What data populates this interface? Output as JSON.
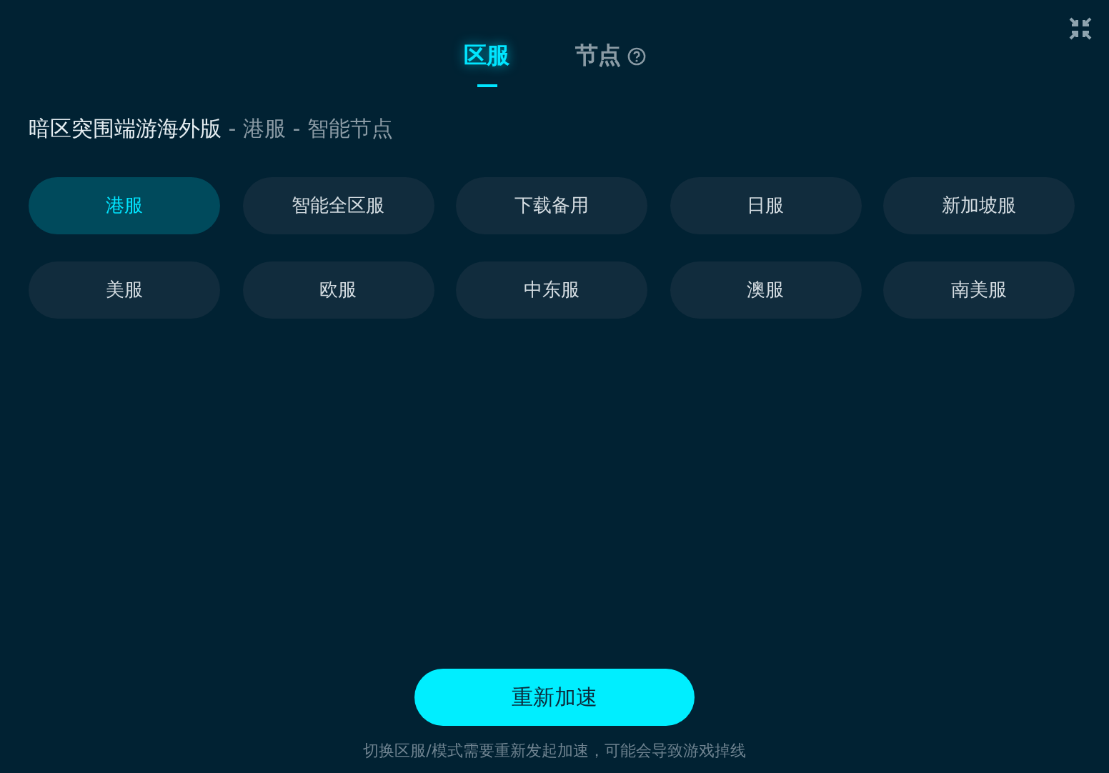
{
  "tabs": [
    {
      "label": "区服",
      "selected": true,
      "help": false
    },
    {
      "label": "节点",
      "selected": false,
      "help": true
    }
  ],
  "heading": {
    "game": "暗区突围端游海外版",
    "detail": " - 港服 - 智能节点"
  },
  "servers": [
    {
      "label": "港服",
      "selected": true
    },
    {
      "label": "智能全区服",
      "selected": false
    },
    {
      "label": "下载备用",
      "selected": false
    },
    {
      "label": "日服",
      "selected": false
    },
    {
      "label": "新加坡服",
      "selected": false
    },
    {
      "label": "美服",
      "selected": false
    },
    {
      "label": "欧服",
      "selected": false
    },
    {
      "label": "中东服",
      "selected": false
    },
    {
      "label": "澳服",
      "selected": false
    },
    {
      "label": "南美服",
      "selected": false
    }
  ],
  "action_button": "重新加速",
  "hint": "切换区服/模式需要重新发起加速，可能会导致游戏掉线"
}
